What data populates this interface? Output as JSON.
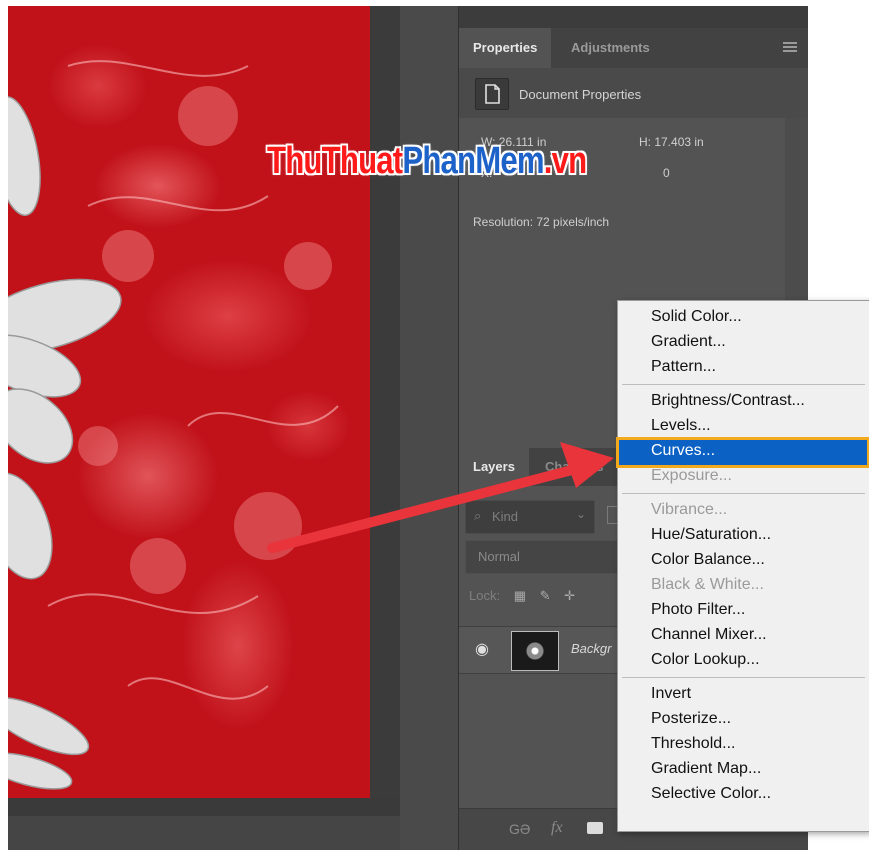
{
  "properties_panel": {
    "tabs": [
      "Properties",
      "Adjustments"
    ],
    "active_tab": "Properties",
    "doc_title": "Document Properties",
    "width_label": "W:  26.111 in",
    "height_label": "H:  17.403 in",
    "x_label": "X:",
    "y_label": "0",
    "resolution": "Resolution: 72 pixels/inch"
  },
  "watermark": {
    "part1": "ThuThuat",
    "part2": "PhanMem",
    "part3": ".vn"
  },
  "layers_panel": {
    "tabs": [
      "Layers",
      "Channels"
    ],
    "active_tab": "Layers",
    "kind_filter": "Kind",
    "blend_mode": "Normal",
    "lock_label": "Lock:",
    "layer_name": "Backgr",
    "footer_link": "GƏ",
    "footer_fx": "fx"
  },
  "context_menu": {
    "groups": [
      [
        {
          "label": "Solid Color...",
          "enabled": true
        },
        {
          "label": "Gradient...",
          "enabled": true
        },
        {
          "label": "Pattern...",
          "enabled": true
        }
      ],
      [
        {
          "label": "Brightness/Contrast...",
          "enabled": true
        },
        {
          "label": "Levels...",
          "enabled": true
        },
        {
          "label": "Curves...",
          "enabled": true,
          "selected": true
        },
        {
          "label": "Exposure...",
          "enabled": false
        }
      ],
      [
        {
          "label": "Vibrance...",
          "enabled": false
        },
        {
          "label": "Hue/Saturation...",
          "enabled": true
        },
        {
          "label": "Color Balance...",
          "enabled": true
        },
        {
          "label": "Black & White...",
          "enabled": false
        },
        {
          "label": "Photo Filter...",
          "enabled": true
        },
        {
          "label": "Channel Mixer...",
          "enabled": true
        },
        {
          "label": "Color Lookup...",
          "enabled": true
        }
      ],
      [
        {
          "label": "Invert",
          "enabled": true
        },
        {
          "label": "Posterize...",
          "enabled": true
        },
        {
          "label": "Threshold...",
          "enabled": true
        },
        {
          "label": "Gradient Map...",
          "enabled": true
        },
        {
          "label": "Selective Color...",
          "enabled": true
        }
      ]
    ]
  },
  "colors": {
    "canvas_red": "#c1121a",
    "panel_bg": "#535353",
    "highlight": "#0b61c4",
    "highlight_border": "#f2a91c",
    "arrow": "#e8343a"
  }
}
